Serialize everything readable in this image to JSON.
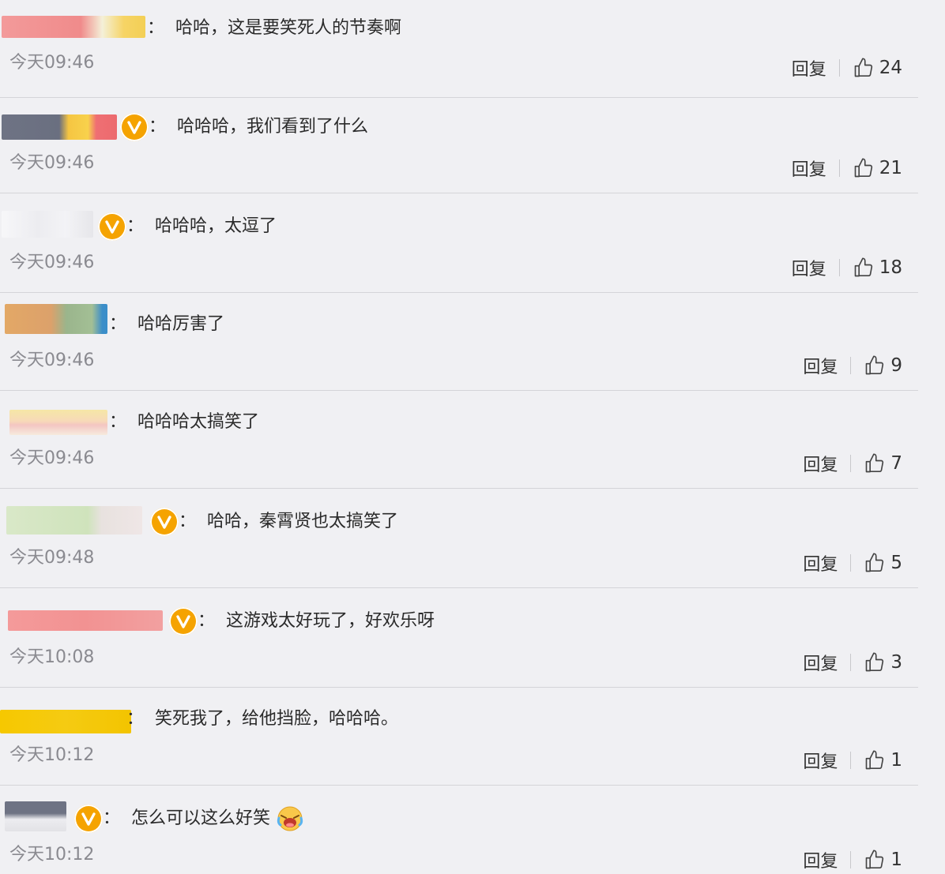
{
  "actions": {
    "reply_label": "回复"
  },
  "comments": [
    {
      "sep": "：",
      "text": "哈哈，这是要笑死人的节奏啊",
      "time": "今天09:46",
      "likes": "24",
      "vip": false,
      "has_emoji": false
    },
    {
      "sep": "：",
      "text": "哈哈哈，我们看到了什么",
      "time": "今天09:46",
      "likes": "21",
      "vip": true,
      "has_emoji": false
    },
    {
      "sep": "：",
      "text": "哈哈哈，太逗了",
      "time": "今天09:46",
      "likes": "18",
      "vip": true,
      "has_emoji": false
    },
    {
      "sep": "：",
      "text": "哈哈厉害了",
      "time": "今天09:46",
      "likes": "9",
      "vip": false,
      "has_emoji": false
    },
    {
      "sep": "：",
      "text": "哈哈哈太搞笑了",
      "time": "今天09:46",
      "likes": "7",
      "vip": false,
      "has_emoji": false
    },
    {
      "sep": "：",
      "text": "哈哈，秦霄贤也太搞笑了",
      "time": "今天09:48",
      "likes": "5",
      "vip": true,
      "has_emoji": false
    },
    {
      "sep": "：",
      "text": "这游戏太好玩了，好欢乐呀",
      "time": "今天10:08",
      "likes": "3",
      "vip": true,
      "has_emoji": false
    },
    {
      "sep": "：",
      "text": "笑死我了，给他挡脸，哈哈哈。",
      "time": "今天10:12",
      "likes": "1",
      "vip": false,
      "has_emoji": false
    },
    {
      "sep": "：",
      "text": "怎么可以这么好笑",
      "time": "今天10:12",
      "likes": "1",
      "vip": true,
      "has_emoji": true
    }
  ],
  "colors": {
    "vip_badge": "#f5a300",
    "background": "#f0f0f3",
    "timestamp": "#8a8a90"
  }
}
